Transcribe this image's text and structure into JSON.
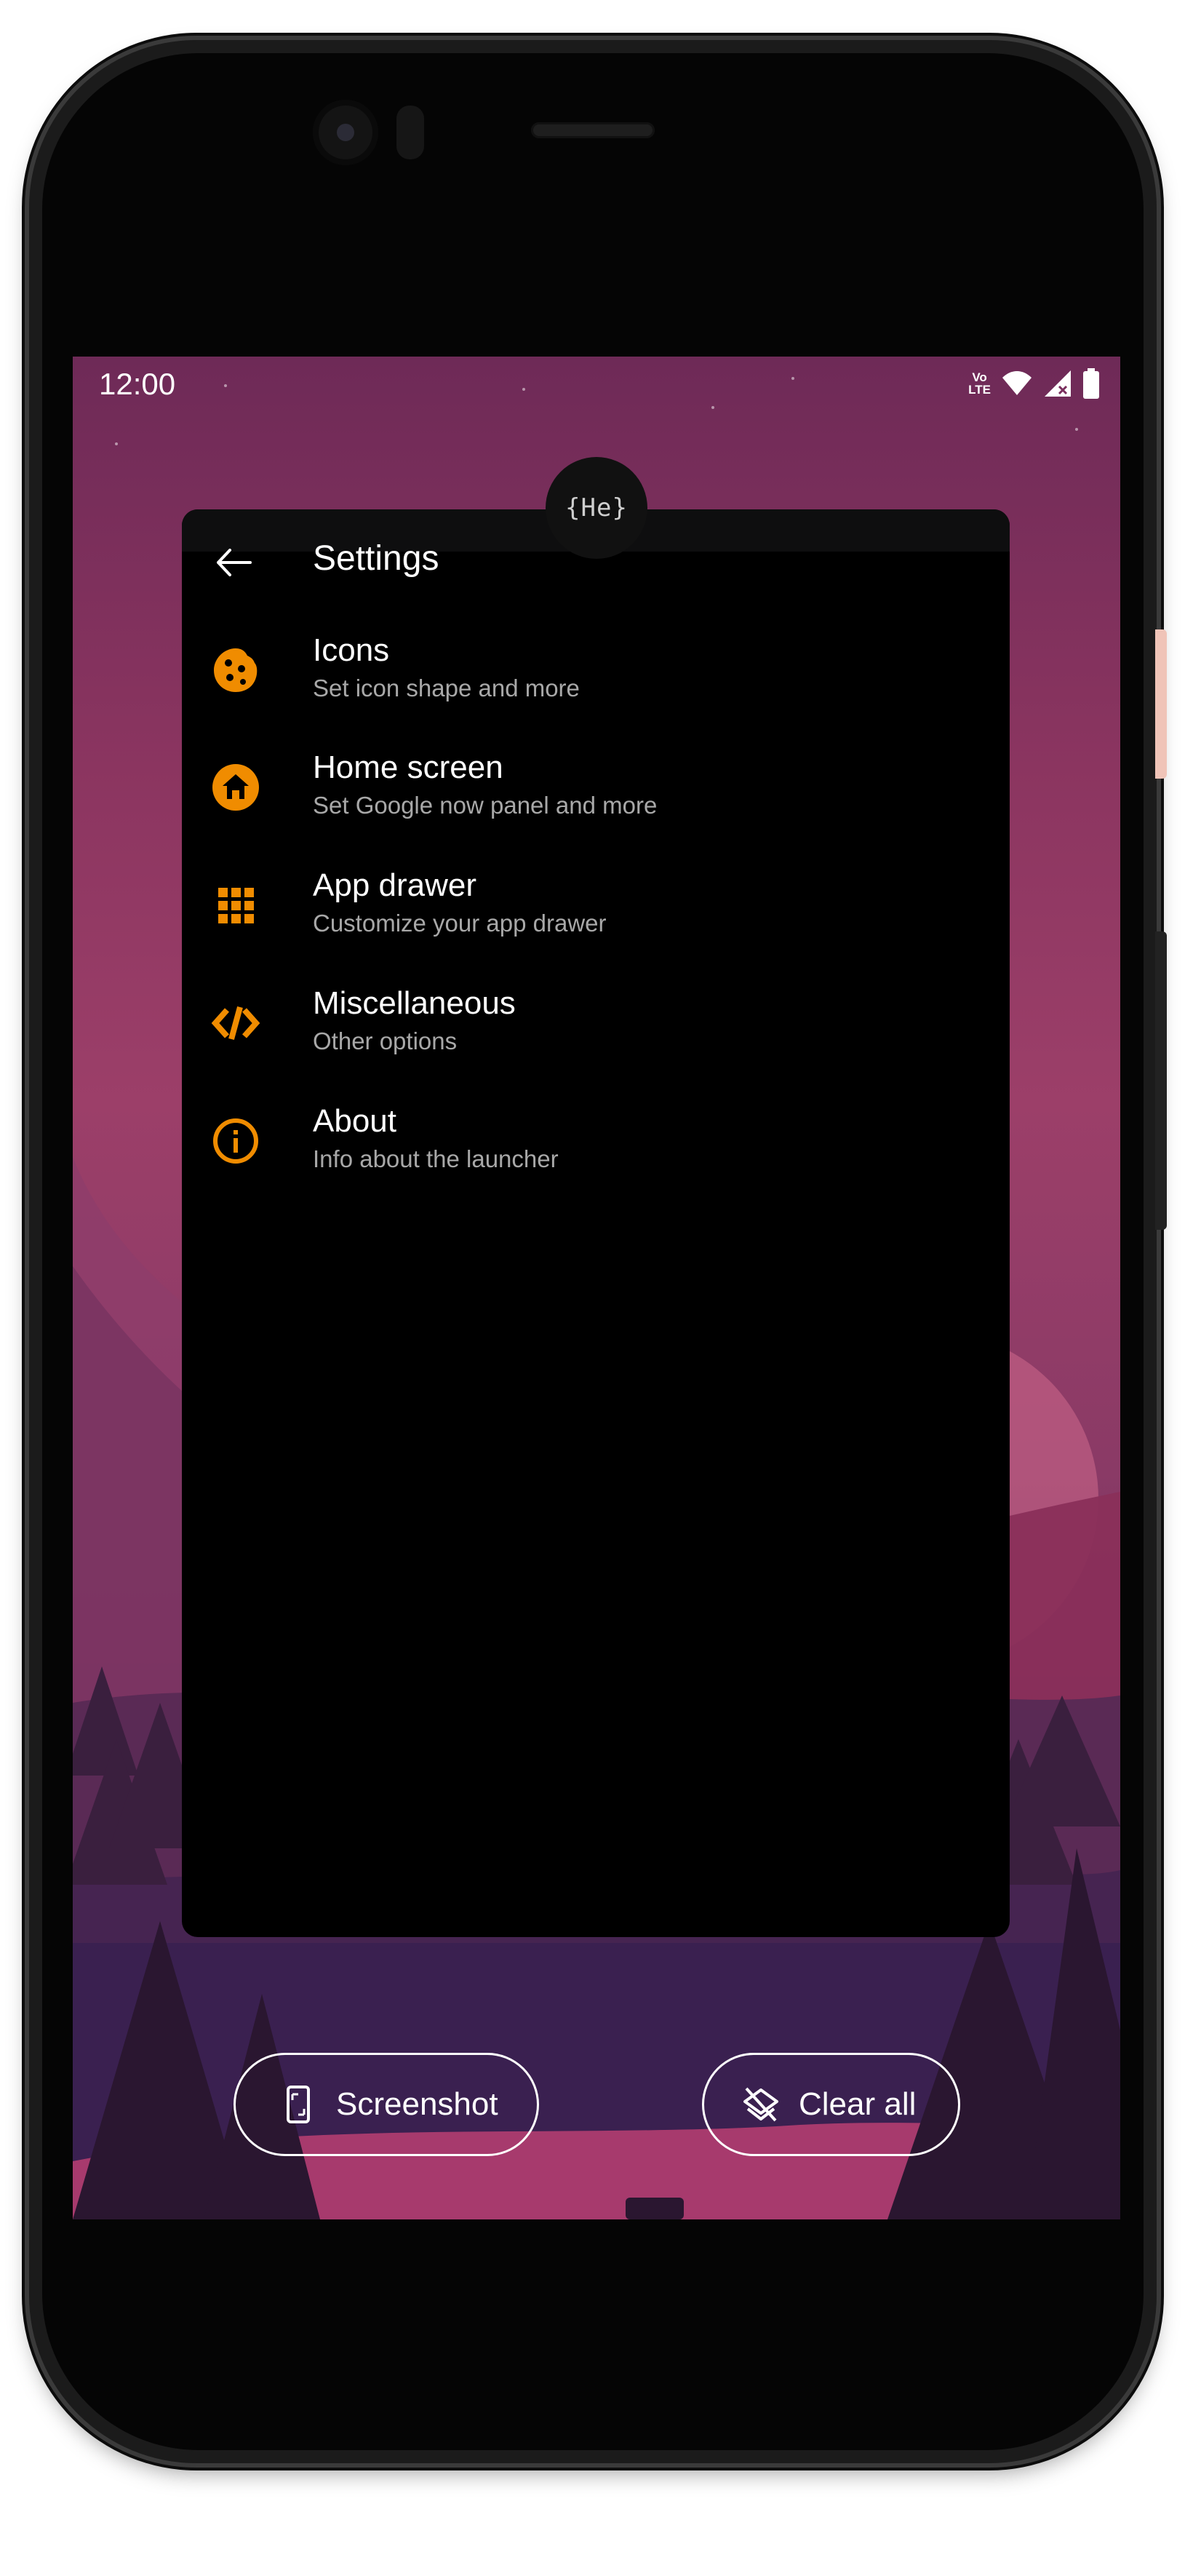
{
  "status_bar": {
    "time": "12:00",
    "network_label": "VoLTE"
  },
  "app": {
    "badge": "{He}"
  },
  "settings": {
    "title": "Settings",
    "items": [
      {
        "icon": "cookie-icon",
        "title": "Icons",
        "subtitle": "Set icon shape and more"
      },
      {
        "icon": "home-icon",
        "title": "Home screen",
        "subtitle": "Set Google now panel and more"
      },
      {
        "icon": "grid-icon",
        "title": "App drawer",
        "subtitle": "Customize your app drawer"
      },
      {
        "icon": "code-icon",
        "title": "Miscellaneous",
        "subtitle": "Other options"
      },
      {
        "icon": "info-icon",
        "title": "About",
        "subtitle": "Info about the launcher"
      }
    ]
  },
  "actions": {
    "screenshot_label": "Screenshot",
    "clear_all_label": "Clear all"
  },
  "colors": {
    "accent": "#f08c00",
    "card_background": "#000000",
    "wallpaper_top": "#6e2a57",
    "wallpaper_bottom": "#3b2149"
  }
}
